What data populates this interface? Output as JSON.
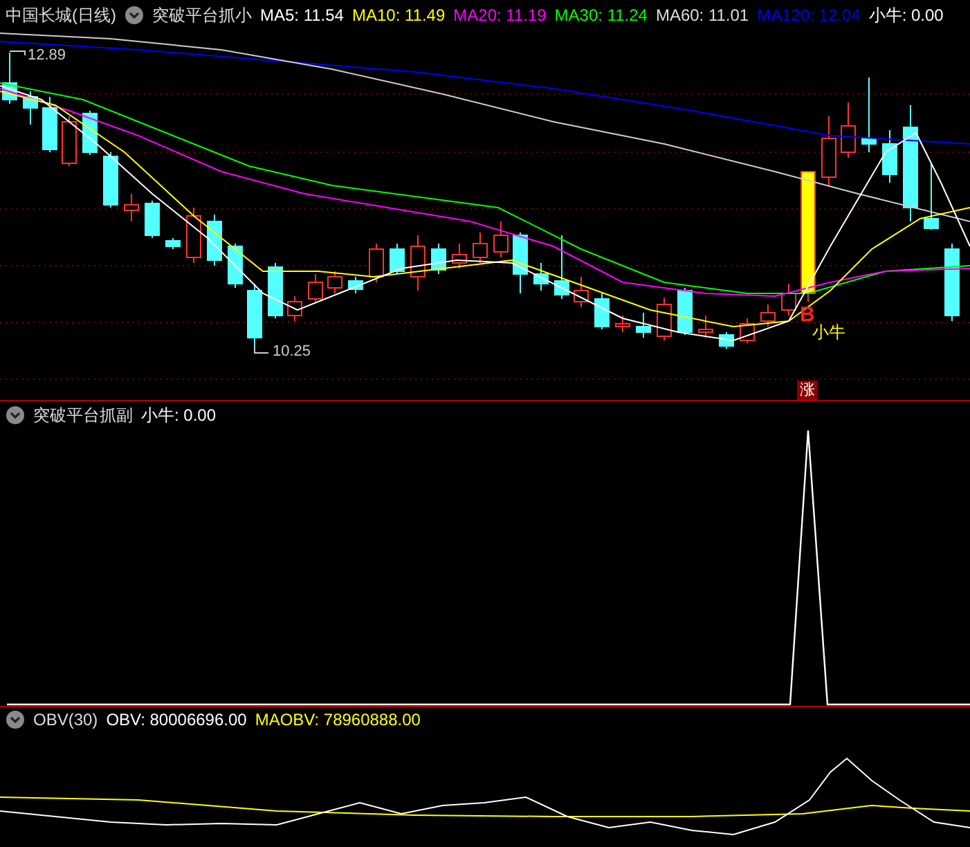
{
  "main_panel": {
    "stock": "中国长城(日线)",
    "indicator": "突破平台抓小",
    "legend": [
      {
        "label": "MA5: 11.54",
        "color": "#ffffff"
      },
      {
        "label": "MA10: 11.49",
        "color": "#ffff00"
      },
      {
        "label": "MA20: 11.19",
        "color": "#ff00ff"
      },
      {
        "label": "MA30: 11.24",
        "color": "#00ff00"
      },
      {
        "label": "MA60: 11.01",
        "color": "#dddddd"
      },
      {
        "label": "MA120: 12.04",
        "color": "#0000ff"
      },
      {
        "label": "小牛: 0.00",
        "color": "#ffffff"
      }
    ],
    "high_marker": "12.89",
    "low_marker": "10.25",
    "signal_letter": "B",
    "signal_label": "小牛",
    "badge": "涨"
  },
  "sub_panel": {
    "indicator": "突破平台抓副",
    "legend": [
      {
        "label": "小牛: 0.00",
        "color": "#ffffff"
      }
    ]
  },
  "obv_panel": {
    "indicator": "OBV(30)",
    "legend": [
      {
        "label": "OBV: 80006696.00",
        "color": "#ffffff"
      },
      {
        "label": "MAOBV: 78960888.00",
        "color": "#ffff00"
      }
    ]
  }
}
